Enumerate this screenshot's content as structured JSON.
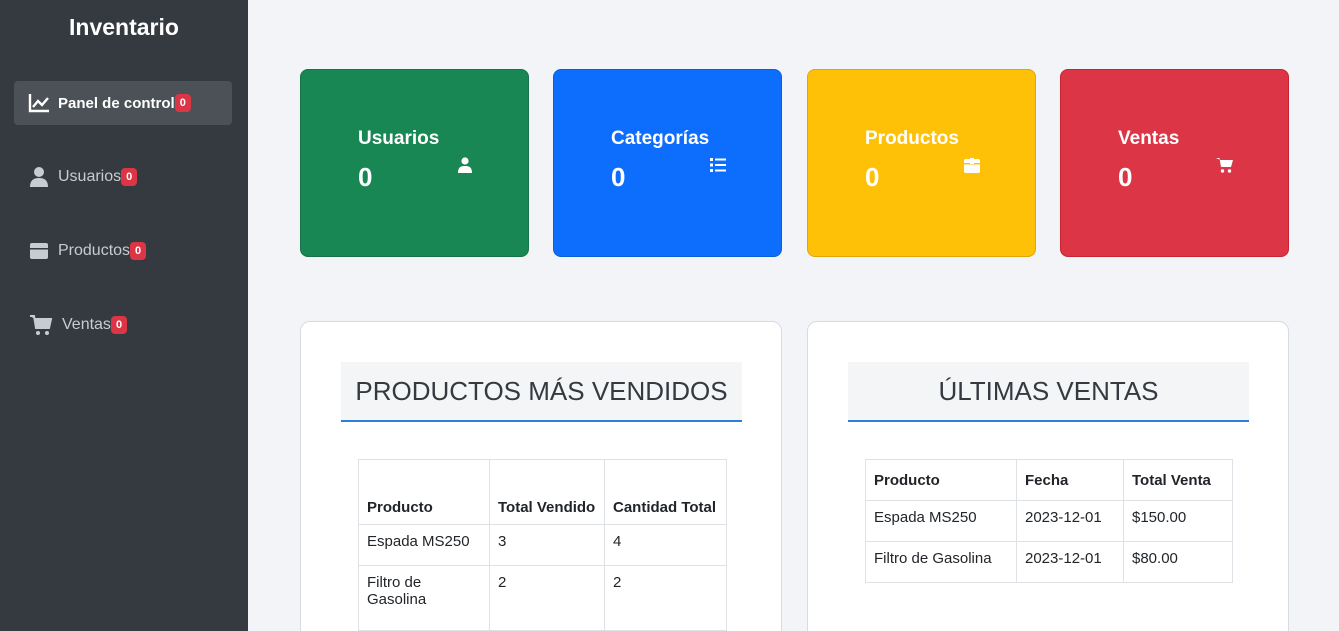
{
  "sidebar": {
    "brand": "Inventario",
    "items": [
      {
        "label": "Panel de control",
        "badge": "0",
        "icon": "chart-line-icon"
      },
      {
        "label": "Usuarios",
        "badge": "0",
        "icon": "user-icon"
      },
      {
        "label": "Productos",
        "badge": "0",
        "icon": "box-icon"
      },
      {
        "label": "Ventas",
        "badge": "0",
        "icon": "cart-icon"
      }
    ]
  },
  "cards": [
    {
      "title": "Usuarios",
      "value": "0",
      "color": "#198754",
      "icon": "user-icon"
    },
    {
      "title": "Categorías",
      "value": "0",
      "color": "#0d6efd",
      "icon": "list-icon"
    },
    {
      "title": "Productos",
      "value": "0",
      "color": "#ffc107",
      "icon": "box-icon"
    },
    {
      "title": "Ventas",
      "value": "0",
      "color": "#dc3545",
      "icon": "cart-icon"
    }
  ],
  "top_products": {
    "title": "PRODUCTOS MÁS VENDIDOS",
    "headers": [
      "Producto",
      "Total Vendido",
      "Cantidad Total"
    ],
    "rows": [
      [
        "Espada MS250",
        "3",
        "4"
      ],
      [
        "Filtro de Gasolina",
        "2",
        "2"
      ]
    ]
  },
  "latest_sales": {
    "title": "ÚLTIMAS VENTAS",
    "headers": [
      "Producto",
      "Fecha",
      "Total Venta"
    ],
    "rows": [
      [
        "Espada MS250",
        "2023-12-01",
        "$150.00"
      ],
      [
        "Filtro de Gasolina",
        "2023-12-01",
        "$80.00"
      ]
    ]
  }
}
